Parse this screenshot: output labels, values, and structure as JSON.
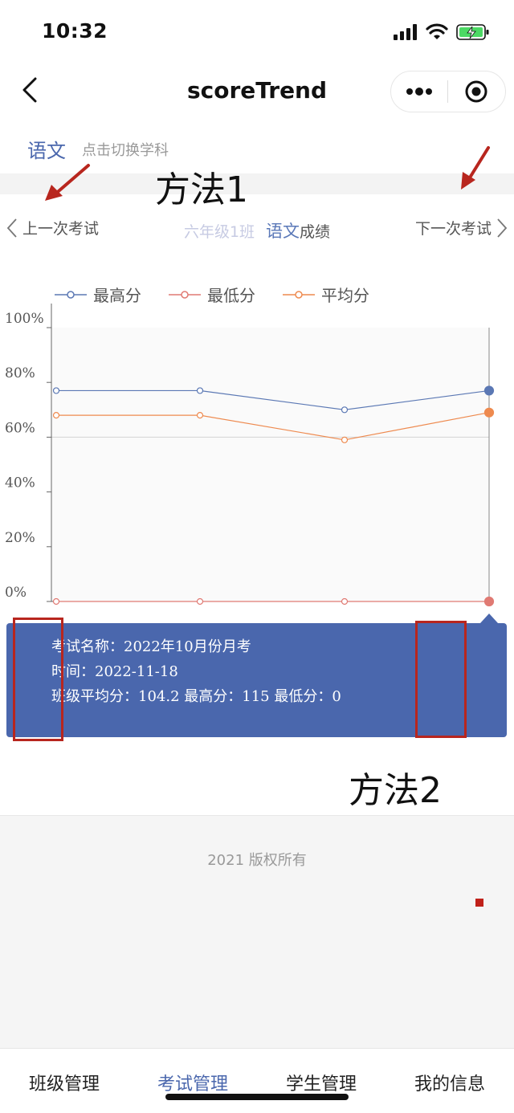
{
  "status_bar": {
    "time": "10:32"
  },
  "nav": {
    "title": "scoreTrend"
  },
  "subject": {
    "name": "语文",
    "hint": "点击切换学科"
  },
  "annotations": {
    "method1": "方法1",
    "method2": "方法2"
  },
  "exam_nav": {
    "prev_label": "上一次考试",
    "next_label": "下一次考试",
    "class_name": "六年级1班",
    "subject": "语文",
    "suffix": "成绩"
  },
  "chart_data": {
    "type": "line",
    "categories": [
      "",
      "",
      "",
      ""
    ],
    "ylim": [
      0,
      100
    ],
    "y_ticks": [
      "0%",
      "20%",
      "40%",
      "60%",
      "80%",
      "100%"
    ],
    "grid": true,
    "legend_position": "top-left",
    "series": [
      {
        "name": "最高分",
        "color": "#5b78b4",
        "values": [
          77,
          77,
          70,
          77
        ]
      },
      {
        "name": "最低分",
        "color": "#e07a73",
        "values": [
          0,
          0,
          0,
          0
        ]
      },
      {
        "name": "平均分",
        "color": "#ee8a4f",
        "values": [
          68,
          68,
          59,
          69
        ]
      }
    ]
  },
  "tooltip": {
    "line1": "考试名称：2022年10月份月考",
    "line2": "时间：2022-11-18",
    "line3": "班级平均分：104.2  最高分：115  最低分：0"
  },
  "footer": {
    "copyright": "2021 版权所有"
  },
  "tabs": [
    {
      "label": "班级管理",
      "active": false
    },
    {
      "label": "考试管理",
      "active": true
    },
    {
      "label": "学生管理",
      "active": false
    },
    {
      "label": "我的信息",
      "active": false
    }
  ],
  "colors": {
    "accent": "#4a67ad",
    "annotation_red": "#b8261e"
  }
}
